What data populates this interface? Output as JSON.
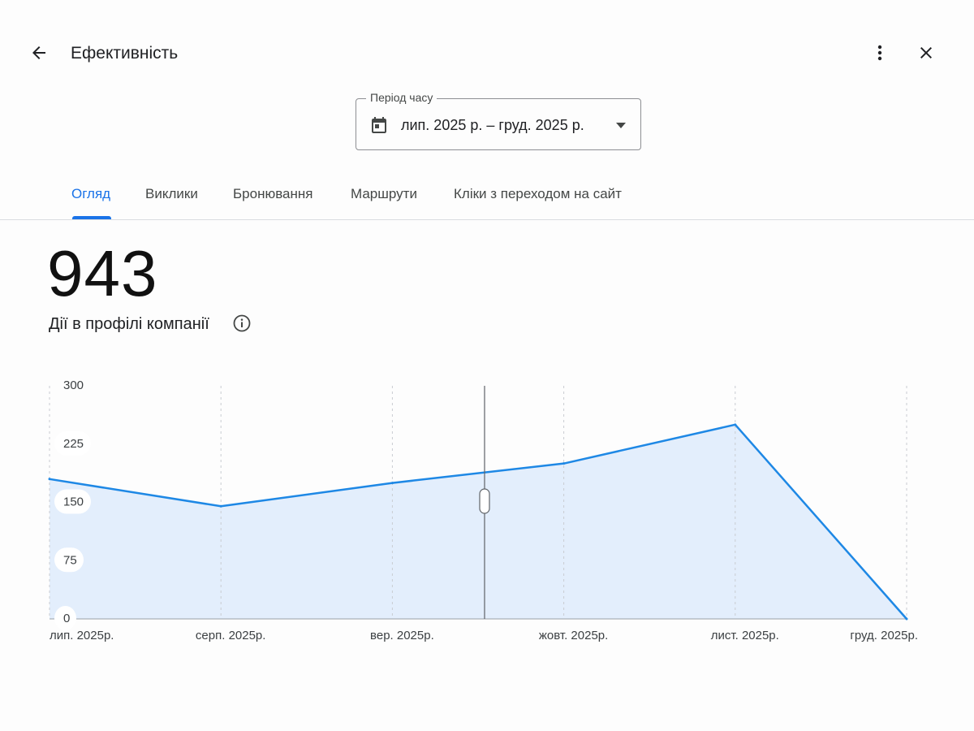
{
  "header": {
    "title": "Ефективність",
    "back_icon": "arrow-back-icon",
    "more_icon": "more-vert-icon",
    "close_icon": "close-icon"
  },
  "period": {
    "label": "Період часу",
    "value": "лип. 2025 р. – груд. 2025 р.",
    "icon": "calendar-icon",
    "dropdown_icon": "arrow-drop-down-icon"
  },
  "tabs": [
    {
      "label": "Огляд",
      "active": true
    },
    {
      "label": "Виклики",
      "active": false
    },
    {
      "label": "Бронювання",
      "active": false
    },
    {
      "label": "Маршрути",
      "active": false
    },
    {
      "label": "Кліки з переходом на сайт",
      "active": false
    }
  ],
  "summary": {
    "total": "943",
    "label": "Дії в профілі компанії",
    "info_icon": "info-icon"
  },
  "colors": {
    "accent": "#1a73e8",
    "line": "#1e88e5",
    "area": "#e3eefc"
  },
  "chart_data": {
    "type": "area",
    "categories": [
      "лип. 2025р.",
      "серп. 2025р.",
      "вер. 2025р.",
      "жовт. 2025р.",
      "лист. 2025р.",
      "груд. 2025р."
    ],
    "values": [
      180,
      145,
      175,
      200,
      250,
      0
    ],
    "y_ticks": [
      "300",
      "225",
      "150",
      "75",
      "0"
    ],
    "ylim": [
      0,
      300
    ],
    "grid": "vertical-dashed",
    "cursor_position": "between вер. 2025р. and жовт. 2025р."
  }
}
